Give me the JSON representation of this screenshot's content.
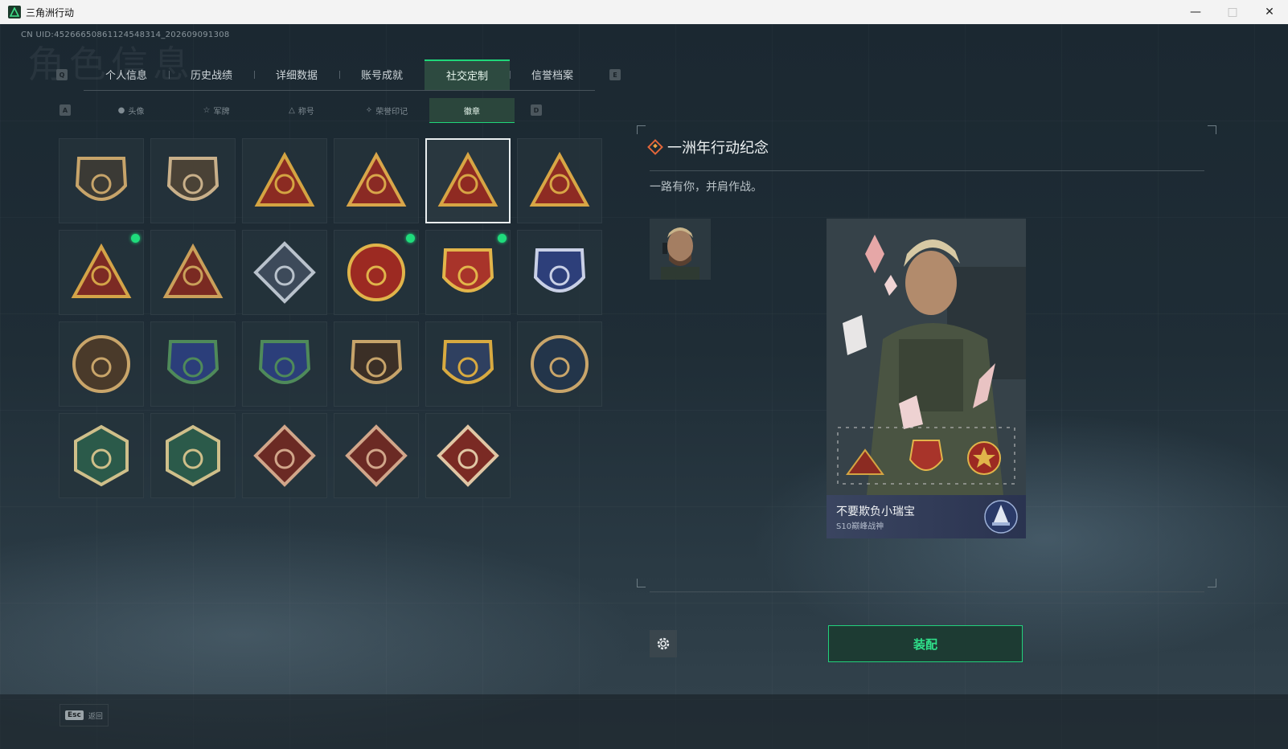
{
  "window": {
    "title": "三角洲行动"
  },
  "uid": "CN UID:45266650861124548314_202609091308",
  "tabs": [
    {
      "label": "个人信息",
      "active": false
    },
    {
      "label": "历史战绩",
      "active": false
    },
    {
      "label": "详细数据",
      "active": false
    },
    {
      "label": "账号成就",
      "active": false
    },
    {
      "label": "社交定制",
      "active": true
    },
    {
      "label": "信誉档案",
      "active": false
    }
  ],
  "tab_keys": {
    "prev": "Q",
    "next": "E"
  },
  "subtabs": [
    {
      "label": "头像",
      "icon": "person-icon"
    },
    {
      "label": "军牌",
      "icon": "dogtag-icon"
    },
    {
      "label": "称号",
      "icon": "title-icon"
    },
    {
      "label": "荣誉印记",
      "icon": "honor-icon"
    },
    {
      "label": "徽章",
      "icon": "",
      "active": true
    }
  ],
  "subtab_keys": {
    "prev": "A",
    "next": "D"
  },
  "badges": [
    {
      "name": "triangle-shield-badge",
      "shape": "shield",
      "color": "#3b3a35",
      "accent": "#c7a46a",
      "new": false,
      "selected": false
    },
    {
      "name": "helicopter-badge",
      "shape": "shield",
      "color": "#4a4236",
      "accent": "#c9b08a",
      "new": false,
      "selected": false
    },
    {
      "name": "tank-59-badge",
      "shape": "triangle",
      "color": "#8b2b22",
      "accent": "#d4a442",
      "new": false,
      "selected": false
    },
    {
      "name": "phoenix-badge",
      "shape": "triangle",
      "color": "#8a2a24",
      "accent": "#d9a64a",
      "new": false,
      "selected": false
    },
    {
      "name": "anniversary-1-badge",
      "shape": "triangle",
      "color": "#8f2a22",
      "accent": "#d7a544",
      "new": false,
      "selected": true
    },
    {
      "name": "anniversary-2-badge",
      "shape": "triangle",
      "color": "#8e2b23",
      "accent": "#d8a645",
      "new": false,
      "selected": false
    },
    {
      "name": "hands-triangle-badge",
      "shape": "triangle",
      "color": "#7c2a24",
      "accent": "#d4a448",
      "new": true,
      "selected": false
    },
    {
      "name": "squad-badge",
      "shape": "triangle",
      "color": "#7a2a22",
      "accent": "#caa05a",
      "new": false,
      "selected": false
    },
    {
      "name": "rose-badge",
      "shape": "diamond",
      "color": "#3d4a5a",
      "accent": "#b9c2cc",
      "new": false,
      "selected": false
    },
    {
      "name": "star-skull-badge",
      "shape": "circle",
      "color": "#9c2a22",
      "accent": "#e0b44a",
      "new": true,
      "selected": false
    },
    {
      "name": "stars-shield-badge",
      "shape": "shield",
      "color": "#a8342a",
      "accent": "#e2b54a",
      "new": true,
      "selected": false
    },
    {
      "name": "d20-shield-badge",
      "shape": "shield",
      "color": "#2d3f7a",
      "accent": "#c9d0e6",
      "new": false,
      "selected": false
    },
    {
      "name": "mask-badge",
      "shape": "circle",
      "color": "#4a3a2a",
      "accent": "#c9a56a",
      "new": false,
      "selected": false
    },
    {
      "name": "rifle-blue-badge",
      "shape": "shield",
      "color": "#2b3e7a",
      "accent": "#4f8a5a",
      "new": false,
      "selected": false
    },
    {
      "name": "rifle-blue-2-badge",
      "shape": "shield",
      "color": "#2b3e7a",
      "accent": "#4f8a5a",
      "new": false,
      "selected": false
    },
    {
      "name": "rifle-brown-badge",
      "shape": "shield",
      "color": "#3b2f26",
      "accent": "#c7a46a",
      "new": false,
      "selected": false
    },
    {
      "name": "rifle-gold-badge",
      "shape": "shield",
      "color": "#2f4060",
      "accent": "#d8aa40",
      "new": false,
      "selected": false
    },
    {
      "name": "eagle-badge",
      "shape": "circle",
      "color": "#23354a",
      "accent": "#c9a56a",
      "new": false,
      "selected": false
    },
    {
      "name": "wasp-badge",
      "shape": "hexagon",
      "color": "#2b5a4a",
      "accent": "#cfbf8a",
      "new": false,
      "selected": false
    },
    {
      "name": "wasp-2-badge",
      "shape": "hexagon",
      "color": "#2b5a4a",
      "accent": "#cfbf8a",
      "new": false,
      "selected": false
    },
    {
      "name": "dragon-badge",
      "shape": "diamond",
      "color": "#6b2a24",
      "accent": "#d1a68a",
      "new": false,
      "selected": false
    },
    {
      "name": "dragon-2-badge",
      "shape": "diamond",
      "color": "#6b2a24",
      "accent": "#d1a68a",
      "new": false,
      "selected": false
    },
    {
      "name": "runner-badge",
      "shape": "diamond",
      "color": "#7a2a24",
      "accent": "#e0c6a4",
      "new": false,
      "selected": false
    }
  ],
  "detail": {
    "title": "一洲年行动纪念",
    "description": "一路有你，并肩作战。"
  },
  "card": {
    "player_name": "不要欺负小瑞宝",
    "rank": "S10巅峰战神"
  },
  "equip_label": "装配",
  "footer": {
    "esc_key": "Esc",
    "esc_label": "返回"
  },
  "colors": {
    "accent": "#1fd67a",
    "background": "#1d2a33"
  }
}
